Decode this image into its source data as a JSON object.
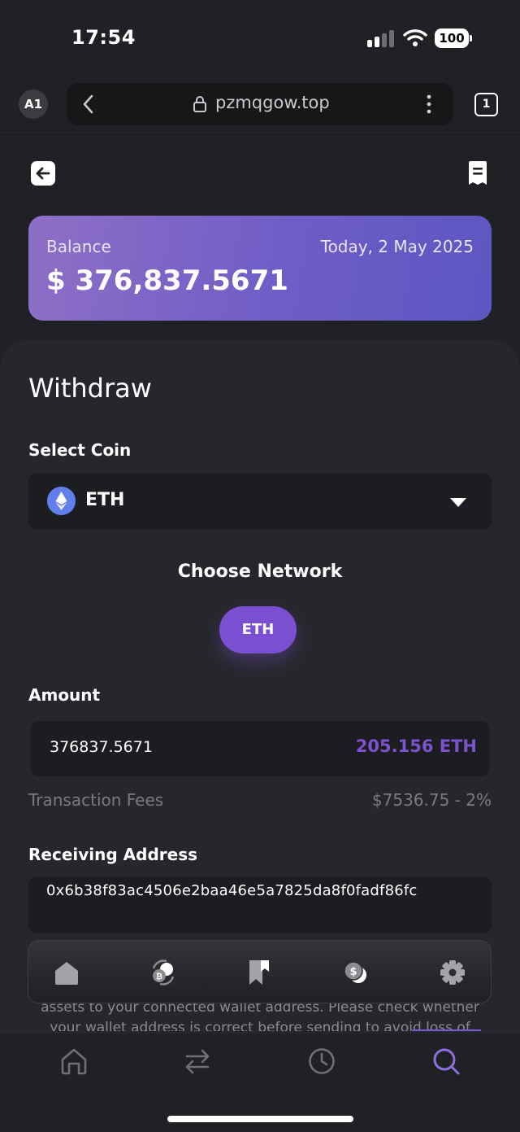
{
  "status_bar": {
    "time": "17:54",
    "battery": "100"
  },
  "browser": {
    "profile": "A1",
    "url": "pzmqgow.top",
    "tab_count": "1"
  },
  "balance": {
    "label": "Balance",
    "date": "Today, 2 May 2025",
    "value": "$ 376,837.5671"
  },
  "withdraw": {
    "title": "Withdraw",
    "select_coin_label": "Select Coin",
    "coin": {
      "name": "ETH",
      "icon": "ethereum-icon"
    },
    "network_title": "Choose Network",
    "network_option": "ETH",
    "amount_label": "Amount",
    "amount_value": "376837.5671",
    "amount_eth": "205.156 ETH",
    "fees_label": "Transaction Fees",
    "fees_value": "$7536.75 - 2%",
    "address_label": "Receiving Address",
    "address_value": "0x6b38f83ac4506e2baa46e5a7825da8f0fadf86fc",
    "notice_line_1": "assets to your connected wallet address. Please check whether",
    "notice_line_2": "your wallet address is correct before sending to avoid loss of"
  },
  "dock": {
    "items": [
      "home-icon",
      "exchange-coins-icon",
      "bookmark-icon",
      "dollar-coins-icon",
      "settings-icon"
    ]
  },
  "bottom_nav": {
    "items": [
      "home-icon",
      "swap-icon",
      "history-icon",
      "search-icon"
    ],
    "active": "search-icon"
  },
  "colors": {
    "accent": "#7b4fd1",
    "background": "#202125",
    "panel": "#26272c",
    "field": "#1c1d21",
    "eth_blue": "#627eea"
  }
}
